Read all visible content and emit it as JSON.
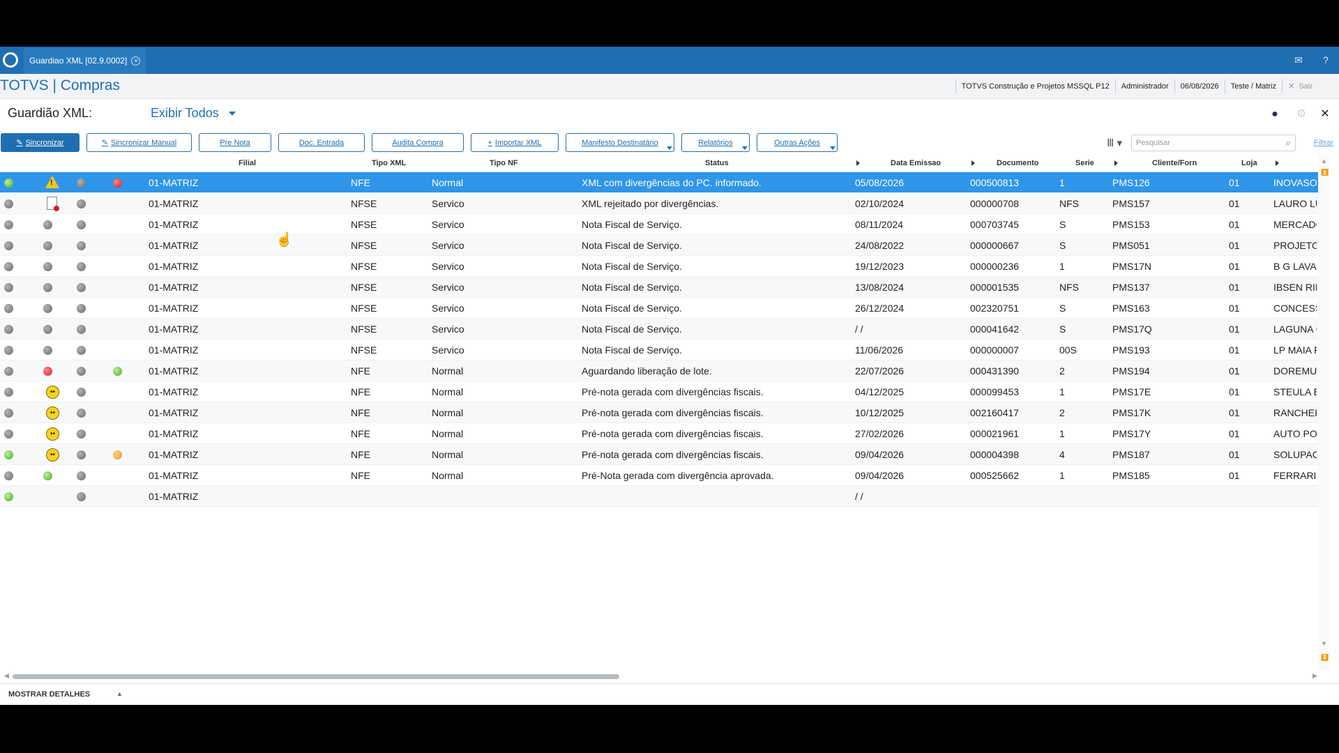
{
  "window": {
    "tab_label": "Guardiao XML [02.9.0002]",
    "tab_close": "×",
    "mail_icon": "mail-icon",
    "help_icon": "help-icon"
  },
  "topbar": {
    "app_title": "TOTVS | Compras",
    "company": "TOTVS Construção e Projetos MSSQL P12",
    "user": "Administrador",
    "date": "06/08/2026",
    "branch": "Teste / Matriz",
    "exit_label": "Sair"
  },
  "header": {
    "title": "Guardião XML:",
    "view_label": "Exibir Todos"
  },
  "toolbar": {
    "sync_label": "Sincronizar",
    "sync_manual_label": "Sincronizar Manual",
    "pre_nota_label": "Pre Nota",
    "doc_entrada_label": "Doc. Entrada",
    "audita_label": "Audita Compra",
    "importar_label": "Importar XML",
    "manifesto_label": "Manifesto Destinatário",
    "relatorios_label": "Relatórios",
    "outras_label": "Outras Ações",
    "search_placeholder": "Pesquisar",
    "filter_label": "Filtrar"
  },
  "columns": {
    "filial": "Filial",
    "tipo_xml": "Tipo XML",
    "tipo_nf": "Tipo NF",
    "status": "Status",
    "data_emissao": "Data Emissao",
    "documento": "Documento",
    "serie": "Serie",
    "cliente": "Cliente/Forn",
    "loja": "Loja"
  },
  "rows": [
    {
      "i1": "green",
      "i2": "warning",
      "i3": "gray",
      "i4": "red",
      "filial": "01-MATRIZ",
      "tipo_xml": "NFE",
      "tipo_nf": "Normal",
      "status": "XML com divergências do PC. informado.",
      "data": "05/08/2026",
      "doc": "000500813",
      "serie": "1",
      "cliente": "PMS126",
      "loja": "01",
      "nome": "INOVASO"
    },
    {
      "i1": "gray",
      "i2": "doc",
      "i3": "gray",
      "i4": "",
      "filial": "01-MATRIZ",
      "tipo_xml": "NFSE",
      "tipo_nf": "Servico",
      "status": "XML rejeitado por divergências.",
      "data": "02/10/2024",
      "doc": "000000708",
      "serie": "NFS",
      "cliente": "PMS157",
      "loja": "01",
      "nome": "LAURO LU"
    },
    {
      "i1": "gray",
      "i2": "gray",
      "i3": "gray",
      "i4": "",
      "filial": "01-MATRIZ",
      "tipo_xml": "NFSE",
      "tipo_nf": "Servico",
      "status": "Nota Fiscal de Serviço.",
      "data": "08/11/2024",
      "doc": "000703745",
      "serie": "S",
      "cliente": "PMS153",
      "loja": "01",
      "nome": "MERCADO"
    },
    {
      "i1": "gray",
      "i2": "gray",
      "i3": "gray",
      "i4": "",
      "filial": "01-MATRIZ",
      "tipo_xml": "NFSE",
      "tipo_nf": "Servico",
      "status": "Nota Fiscal de Serviço.",
      "data": "24/08/2022",
      "doc": "000000667",
      "serie": "S",
      "cliente": "PMS051",
      "loja": "01",
      "nome": "PROJETO"
    },
    {
      "i1": "gray",
      "i2": "gray",
      "i3": "gray",
      "i4": "",
      "filial": "01-MATRIZ",
      "tipo_xml": "NFSE",
      "tipo_nf": "Servico",
      "status": "Nota Fiscal de Serviço.",
      "data": "19/12/2023",
      "doc": "000000236",
      "serie": "1",
      "cliente": "PMS17N",
      "loja": "01",
      "nome": "B G LAVAI"
    },
    {
      "i1": "gray",
      "i2": "gray",
      "i3": "gray",
      "i4": "",
      "filial": "01-MATRIZ",
      "tipo_xml": "NFSE",
      "tipo_nf": "Servico",
      "status": "Nota Fiscal de Serviço.",
      "data": "13/08/2024",
      "doc": "000001535",
      "serie": "NFS",
      "cliente": "PMS137",
      "loja": "01",
      "nome": "IBSEN RIB"
    },
    {
      "i1": "gray",
      "i2": "gray",
      "i3": "gray",
      "i4": "",
      "filial": "01-MATRIZ",
      "tipo_xml": "NFSE",
      "tipo_nf": "Servico",
      "status": "Nota Fiscal de Serviço.",
      "data": "26/12/2024",
      "doc": "002320751",
      "serie": "S",
      "cliente": "PMS163",
      "loja": "01",
      "nome": "CONCESS"
    },
    {
      "i1": "gray",
      "i2": "gray",
      "i3": "gray",
      "i4": "",
      "filial": "01-MATRIZ",
      "tipo_xml": "NFSE",
      "tipo_nf": "Servico",
      "status": "Nota Fiscal de Serviço.",
      "data": " /  /",
      "doc": "000041642",
      "serie": "S",
      "cliente": "PMS17Q",
      "loja": "01",
      "nome": "LAGUNA C"
    },
    {
      "i1": "gray",
      "i2": "gray",
      "i3": "gray",
      "i4": "",
      "filial": "01-MATRIZ",
      "tipo_xml": "NFSE",
      "tipo_nf": "Servico",
      "status": "Nota Fiscal de Serviço.",
      "data": "11/06/2026",
      "doc": "000000007",
      "serie": "00S",
      "cliente": "PMS193",
      "loja": "01",
      "nome": "LP MAIA F"
    },
    {
      "i1": "gray",
      "i2": "red",
      "i3": "gray",
      "i4": "green",
      "filial": "01-MATRIZ",
      "tipo_xml": "NFE",
      "tipo_nf": "Normal",
      "status": "Aguardando liberação de lote.",
      "data": "22/07/2026",
      "doc": "000431390",
      "serie": "2",
      "cliente": "PMS194",
      "loja": "01",
      "nome": "DOREMUS"
    },
    {
      "i1": "gray",
      "i2": "face",
      "i3": "gray",
      "i4": "",
      "filial": "01-MATRIZ",
      "tipo_xml": "NFE",
      "tipo_nf": "Normal",
      "status": "Pré-nota gerada com divergências fiscais.",
      "data": "04/12/2025",
      "doc": "000099453",
      "serie": "1",
      "cliente": "PMS17E",
      "loja": "01",
      "nome": "STEULA E"
    },
    {
      "i1": "gray",
      "i2": "face",
      "i3": "gray",
      "i4": "",
      "filial": "01-MATRIZ",
      "tipo_xml": "NFE",
      "tipo_nf": "Normal",
      "status": "Pré-nota gerada com divergências fiscais.",
      "data": "10/12/2025",
      "doc": "002160417",
      "serie": "2",
      "cliente": "PMS17K",
      "loja": "01",
      "nome": "RANCHEI"
    },
    {
      "i1": "gray",
      "i2": "face",
      "i3": "gray",
      "i4": "",
      "filial": "01-MATRIZ",
      "tipo_xml": "NFE",
      "tipo_nf": "Normal",
      "status": "Pré-nota gerada com divergências fiscais.",
      "data": "27/02/2026",
      "doc": "000021961",
      "serie": "1",
      "cliente": "PMS17Y",
      "loja": "01",
      "nome": "AUTO PO"
    },
    {
      "i1": "green",
      "i2": "face",
      "i3": "gray",
      "i4": "orange",
      "filial": "01-MATRIZ",
      "tipo_xml": "NFE",
      "tipo_nf": "Normal",
      "status": "Pré-nota gerada com divergências fiscais.",
      "data": "09/04/2026",
      "doc": "000004398",
      "serie": "4",
      "cliente": "PMS187",
      "loja": "01",
      "nome": "SOLUPAC"
    },
    {
      "i1": "gray",
      "i2": "green",
      "i3": "gray",
      "i4": "",
      "filial": "01-MATRIZ",
      "tipo_xml": "NFE",
      "tipo_nf": "Normal",
      "status": "Pré-Nota gerada com divergência aprovada.",
      "data": "09/04/2026",
      "doc": "000525662",
      "serie": "1",
      "cliente": "PMS185",
      "loja": "01",
      "nome": "FERRARI"
    },
    {
      "i1": "green",
      "i2": "",
      "i3": "gray",
      "i4": "",
      "filial": "01-MATRIZ",
      "tipo_xml": "",
      "tipo_nf": "",
      "status": "",
      "data": " /  /",
      "doc": "",
      "serie": "",
      "cliente": "",
      "loja": "",
      "nome": ""
    }
  ],
  "footer": {
    "details_label": "MOSTRAR DETALHES"
  }
}
